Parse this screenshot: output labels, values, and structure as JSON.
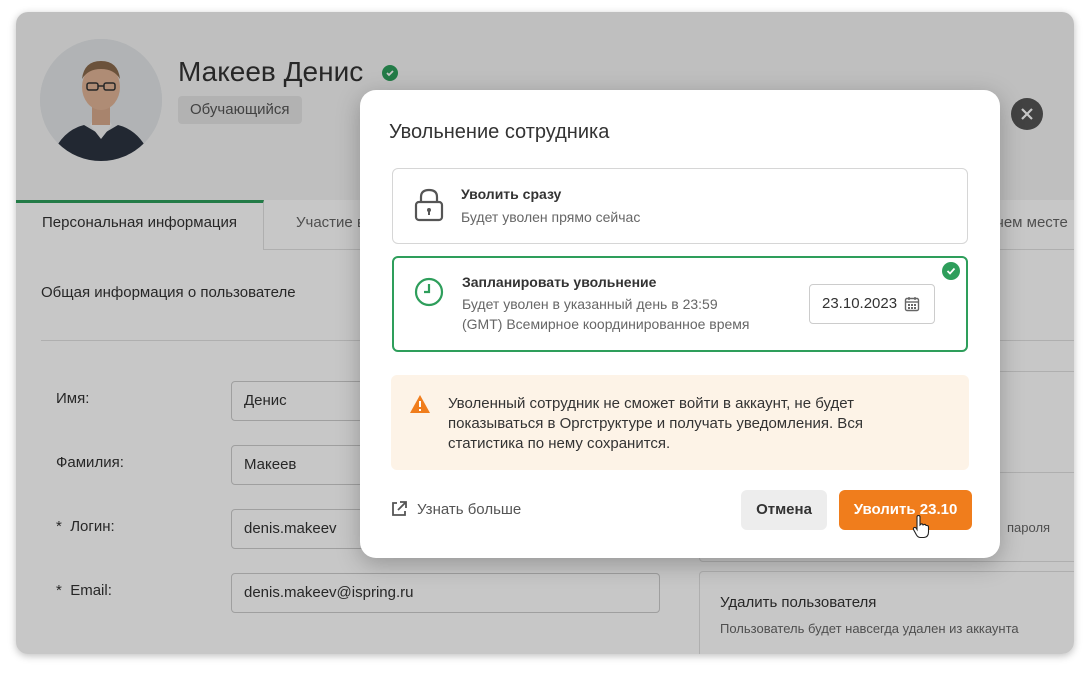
{
  "profile": {
    "name": "Макеев Денис",
    "role": "Обучающийся"
  },
  "tabs": [
    {
      "label": "Персональная информация"
    },
    {
      "label": "Участие в"
    },
    {
      "label": "чем месте"
    }
  ],
  "section": {
    "title": "Общая информация о пользователе"
  },
  "form": {
    "first_name_label": "Имя:",
    "first_name_value": "Денис",
    "last_name_label": "Фамилия:",
    "last_name_value": "Макеев",
    "login_label": "Логин:",
    "login_value": "denis.makeev",
    "email_label": "Email:",
    "email_value": "denis.makeev@ispring.ru",
    "required_mark": "*"
  },
  "side_cards": {
    "password_fragment": "пароля",
    "delete_title": "Удалить пользователя",
    "delete_desc": "Пользователь будет навсегда удален из аккаунта"
  },
  "dialog": {
    "title": "Увольнение сотрудника",
    "option_now": {
      "title": "Уволить сразу",
      "desc": "Будет уволен прямо сейчас"
    },
    "option_scheduled": {
      "title": "Запланировать увольнение",
      "desc_line1": "Будет уволен в указанный день в 23:59",
      "desc_line2": "(GMT) Всемирное координированное время",
      "date": "23.10.2023"
    },
    "warning": "Уволенный сотрудник не сможет войти в аккаунт, не будет показываться в Оргструктуре и получать уведомления. Вся статистика по нему сохранится.",
    "learn_more": "Узнать больше",
    "cancel": "Отмена",
    "confirm": "Уволить 23.10"
  },
  "colors": {
    "accent_green": "#2e9e5b",
    "primary_orange": "#f07d1c",
    "warning_bg": "#fdf3e7"
  }
}
